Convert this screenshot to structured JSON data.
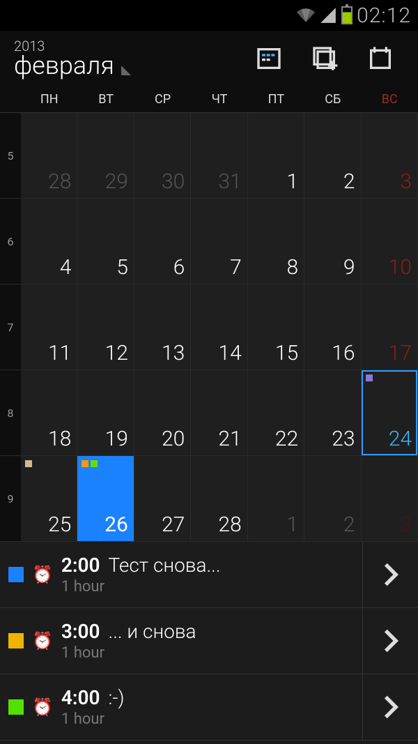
{
  "status": {
    "time": "02:12"
  },
  "header": {
    "year": "2013",
    "month": "февраля"
  },
  "weekdays": [
    "ПН",
    "ВТ",
    "СР",
    "ЧТ",
    "ПТ",
    "СБ",
    "ВС"
  ],
  "weeknums": [
    "5",
    "6",
    "7",
    "8",
    "9"
  ],
  "days": [
    {
      "n": "28",
      "other": true
    },
    {
      "n": "29",
      "other": true
    },
    {
      "n": "30",
      "other": true
    },
    {
      "n": "31",
      "other": true
    },
    {
      "n": "1"
    },
    {
      "n": "2"
    },
    {
      "n": "3",
      "sun": true
    },
    {
      "n": "4"
    },
    {
      "n": "5"
    },
    {
      "n": "6"
    },
    {
      "n": "7"
    },
    {
      "n": "8"
    },
    {
      "n": "9"
    },
    {
      "n": "10",
      "sun": true
    },
    {
      "n": "11"
    },
    {
      "n": "12"
    },
    {
      "n": "13"
    },
    {
      "n": "14"
    },
    {
      "n": "15"
    },
    {
      "n": "16"
    },
    {
      "n": "17",
      "sun": true
    },
    {
      "n": "18"
    },
    {
      "n": "19"
    },
    {
      "n": "20"
    },
    {
      "n": "21"
    },
    {
      "n": "22"
    },
    {
      "n": "23"
    },
    {
      "n": "24",
      "sun": true,
      "today": true,
      "dots": [
        "#8a78d6"
      ]
    },
    {
      "n": "25",
      "dots": [
        "#d4b896"
      ]
    },
    {
      "n": "26",
      "selected": true,
      "dots": [
        "#ff9900",
        "#66dd00"
      ]
    },
    {
      "n": "27"
    },
    {
      "n": "28"
    },
    {
      "n": "1",
      "other": true
    },
    {
      "n": "2",
      "other": true
    },
    {
      "n": "3",
      "other": true,
      "sun": true
    }
  ],
  "events": [
    {
      "color": "#1a82ff",
      "time": "2:00",
      "title": "Тест снова...",
      "duration": "1 hour"
    },
    {
      "color": "#f0b400",
      "time": "3:00",
      "title": "... и снова",
      "duration": "1 hour"
    },
    {
      "color": "#54e000",
      "time": "4:00",
      "title": ":-)",
      "duration": "1 hour"
    }
  ]
}
